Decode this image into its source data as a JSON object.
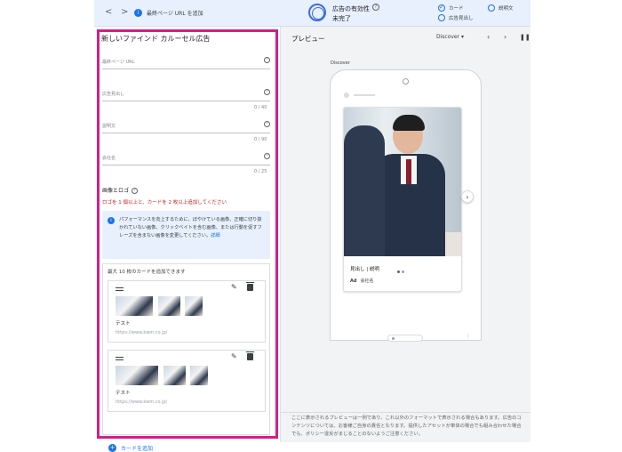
{
  "topbar": {
    "url_label": "最終ページ URL を追加",
    "effectiveness_title": "広告の有効性",
    "effectiveness_status": "未完了",
    "checks": [
      {
        "label": "カード",
        "done": true
      },
      {
        "label": "説明文",
        "done": false
      },
      {
        "label": "広告見出し",
        "done": false
      }
    ]
  },
  "form": {
    "title": "新しいファインド カルーセル広告",
    "fields": [
      {
        "label": "最終ページ URL",
        "counter": ""
      },
      {
        "label": "広告見出し",
        "counter": "0 / 40"
      },
      {
        "label": "説明文",
        "counter": "0 / 90"
      },
      {
        "label": "会社名",
        "counter": "0 / 25"
      }
    ],
    "image_section_title": "画像とロゴ",
    "requirement": "ロゴを 1 個以上と、カードを 2 枚以上追加してください",
    "info_text": "パフォーマンスを向上するために、ぼやけている画像、正確に切り抜かれていない画像、クリックベイトを含む画像、または行動を促すフレーズを含まない画像を変更してください。",
    "info_link": "詳細",
    "cards_header": "最大 10 枚のカードを追加できます",
    "cards": [
      {
        "name": "テスト",
        "url": "https://www.kwm.co.jp/"
      },
      {
        "name": "テスト",
        "url": "https://www.kwm.co.jp/"
      }
    ],
    "add_card": "カードを追加"
  },
  "preview": {
    "title": "プレビュー",
    "placement": "Discover",
    "discover_label": "Discover",
    "ad_title": "見出し | 説明",
    "ad_badge": "Ad",
    "ad_company": "会社名",
    "disclaimer": "ここに表示されるプレビューは一例であり、これ以外のフォーマットで表示される場合もあります。広告のコンテンツについては、お客様ご自身の責任となります。提供したアセットが単体の場合でも組み合わせた場合でも、ポリシー違反がまじることのないようご注意ください。"
  },
  "colors": {
    "highlight": "#d21e8c",
    "accent": "#1a73e8"
  }
}
